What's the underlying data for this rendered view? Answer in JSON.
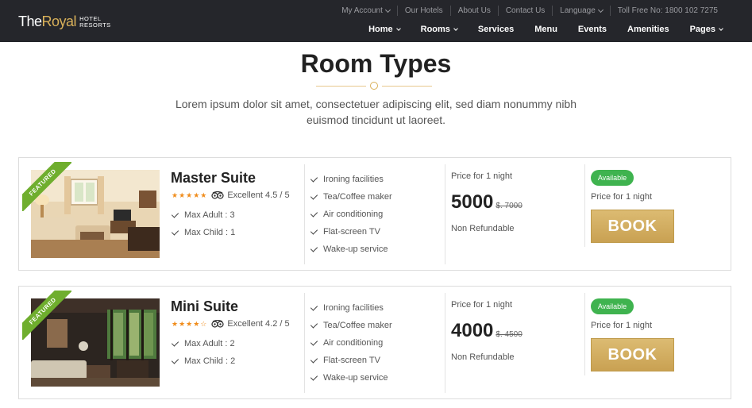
{
  "header": {
    "logo_the_royal": "TheRoyal",
    "logo_hotel": "HOTEL",
    "logo_resorts": "RESORTS",
    "top_links": [
      "My Account",
      "Our Hotels",
      "About Us",
      "Contact Us",
      "Language",
      "Toll Free No: 1800 102 7275"
    ],
    "nav": [
      "Home",
      "Rooms",
      "Services",
      "Menu",
      "Events",
      "Amenities",
      "Pages"
    ]
  },
  "page": {
    "title": "Room Types",
    "subtitle_line1": "Lorem ipsum dolor sit amet, consectetuer adipiscing elit, sed diam nonummy nibh",
    "subtitle_line2": "euismod tincidunt ut laoreet."
  },
  "rooms": [
    {
      "ribbon": "FEATURED",
      "name": "Master Suite",
      "stars_filled": 5,
      "rating_text": "Excellent 4.5 / 5",
      "max_adult": "Max Adult : 3",
      "max_child": "Max Child : 1",
      "amenities": [
        "Ironing facilities",
        "Tea/Coffee maker",
        "Air conditioning",
        "Flat-screen TV",
        "Wake-up service"
      ],
      "price_label": "Price for 1 night",
      "price": "5000",
      "old_price": "$. 7000",
      "policy": "Non Refundable",
      "availability": "Available",
      "book_price_label": "Price for 1 night",
      "book_button": "BOOK"
    },
    {
      "ribbon": "FEATURED",
      "name": "Mini Suite",
      "stars_filled": 4,
      "rating_text": "Excellent 4.2 / 5",
      "max_adult": "Max Adult : 2",
      "max_child": "Max Child : 2",
      "amenities": [
        "Ironing facilities",
        "Tea/Coffee maker",
        "Air conditioning",
        "Flat-screen TV",
        "Wake-up service"
      ],
      "price_label": "Price for 1 night",
      "price": "4000",
      "old_price": "$. 4500",
      "policy": "Non Refundable",
      "availability": "Available",
      "book_price_label": "Price for 1 night",
      "book_button": "BOOK"
    }
  ],
  "colors": {
    "header_bg": "#25262b",
    "gold": "#d9b15a",
    "featured_green": "#6fae2e",
    "available_green": "#3fb34f",
    "star_orange": "#f08c1b"
  }
}
